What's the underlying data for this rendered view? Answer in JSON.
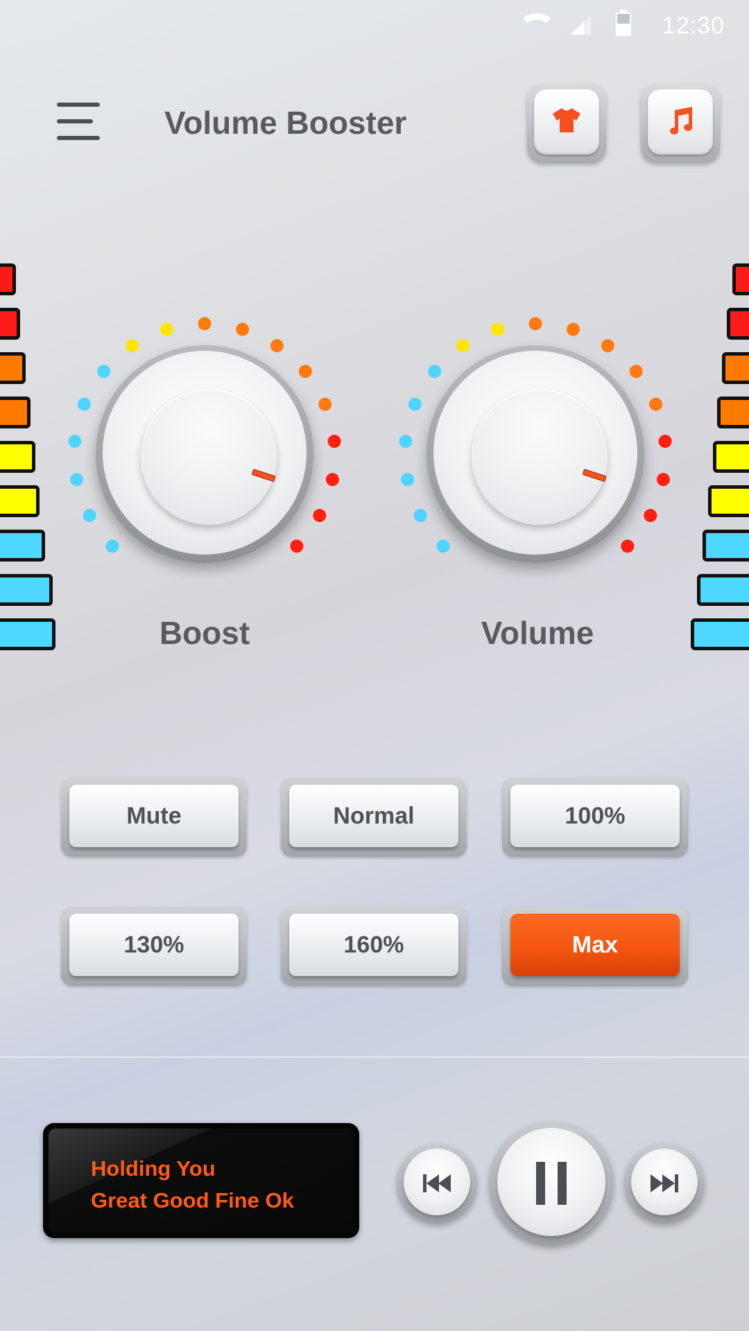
{
  "status_bar": {
    "time": "12:30",
    "icons": [
      "wifi-icon",
      "signal-icon",
      "battery-icon"
    ]
  },
  "header": {
    "title": "Volume Booster",
    "menu_icon": "hamburger-menu-icon",
    "buttons": [
      {
        "icon": "tshirt-icon"
      },
      {
        "icon": "music-note-icon"
      }
    ]
  },
  "knobs": [
    {
      "label": "Boost",
      "level": 0.9
    },
    {
      "label": "Volume",
      "level": 0.9
    }
  ],
  "presets": [
    {
      "label": "Mute",
      "active": false
    },
    {
      "label": "Normal",
      "active": false
    },
    {
      "label": "100%",
      "active": false
    },
    {
      "label": "130%",
      "active": false
    },
    {
      "label": "160%",
      "active": false
    },
    {
      "label": "Max",
      "active": true
    }
  ],
  "now_playing": {
    "line1": "Holding You",
    "line2": "Great Good Fine Ok"
  },
  "player": {
    "prev_icon": "skip-previous-icon",
    "play_pause_icon": "pause-icon",
    "next_icon": "skip-next-icon"
  },
  "colors": {
    "accent": "#f4511e",
    "vu_red": "#ff1a1a",
    "vu_orange": "#ff7a00",
    "vu_yellow": "#ffff00",
    "vu_cyan": "#4fd8ff",
    "dot_cyan": "#4fd4ff",
    "dot_yellow": "#ffe600",
    "dot_orange": "#ff7a10",
    "dot_red": "#ff2010"
  }
}
